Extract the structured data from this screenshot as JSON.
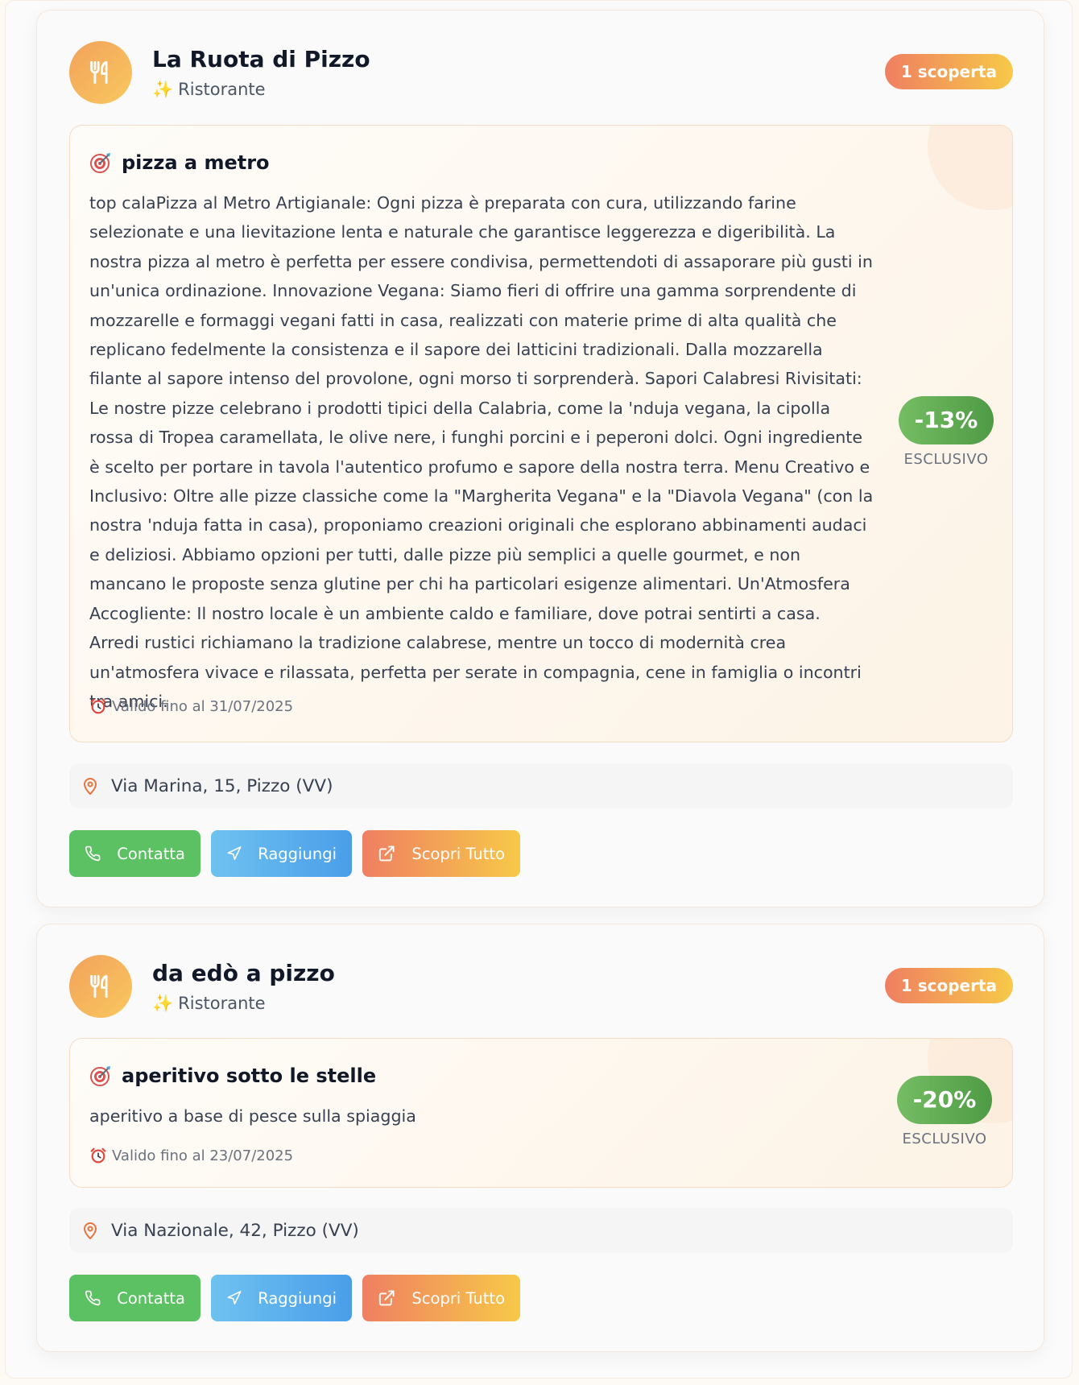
{
  "cards": [
    {
      "name": "La Ruota di Pizzo",
      "category": "Ristorante",
      "badge": "1 scoperta",
      "offer": {
        "title": "pizza a metro",
        "description": "top calaPizza al Metro Artigianale: Ogni pizza è preparata con cura, utilizzando farine selezionate e una lievitazione lenta e naturale che garantisce leggerezza e digeribilità. La nostra pizza al metro è perfetta per essere condivisa, permettendoti di assaporare più gusti in un'unica ordinazione. Innovazione Vegana: Siamo fieri di offrire una gamma sorprendente di mozzarelle e formaggi vegani fatti in casa, realizzati con materie prime di alta qualità che replicano fedelmente la consistenza e il sapore dei latticini tradizionali. Dalla mozzarella filante al sapore intenso del provolone, ogni morso ti sorprenderà. Sapori Calabresi Rivisitati: Le nostre pizze celebrano i prodotti tipici della Calabria, come la 'nduja vegana, la cipolla rossa di Tropea caramellata, le olive nere, i funghi porcini e i peperoni dolci. Ogni ingrediente è scelto per portare in tavola l'autentico profumo e sapore della nostra terra. Menu Creativo e Inclusivo: Oltre alle pizze classiche come la \"Margherita Vegana\" e la \"Diavola Vegana\" (con la nostra 'nduja fatta in casa), proponiamo creazioni originali che esplorano abbinamenti audaci e deliziosi. Abbiamo opzioni per tutti, dalle pizze più semplici a quelle gourmet, e non mancano le proposte senza glutine per chi ha particolari esigenze alimentari. Un'Atmosfera Accogliente: Il nostro locale è un ambiente caldo e familiare, dove potrai sentirti a casa. Arredi rustici richiamano la tradizione calabrese, mentre un tocco di modernità crea un'atmosfera vivace e rilassata, perfetta per serate in compagnia, cene in famiglia o incontri tra amici.",
        "validity": "Valido fino al 31/07/2025",
        "discount": "-13%",
        "exclusive_label": "ESCLUSIVO"
      },
      "address": "Via Marina, 15, Pizzo (VV)",
      "actions": {
        "contact": "Contatta",
        "route": "Raggiungi",
        "discover": "Scopri Tutto"
      }
    },
    {
      "name": "da edò a pizzo",
      "category": "Ristorante",
      "badge": "1 scoperta",
      "offer": {
        "title": "aperitivo sotto le stelle",
        "description": "aperitivo a base di pesce sulla spiaggia",
        "validity": "Valido fino al 23/07/2025",
        "discount": "-20%",
        "exclusive_label": "ESCLUSIVO"
      },
      "address": "Via Nazionale, 42, Pizzo (VV)",
      "actions": {
        "contact": "Contatta",
        "route": "Raggiungi",
        "discover": "Scopri Tutto"
      }
    }
  ],
  "icons": {
    "avatar": "fork-knife-icon",
    "category": "sparkles-icon",
    "offer": "target-icon",
    "validity": "alarm-clock-icon",
    "address": "map-pin-icon",
    "contact": "phone-icon",
    "route": "navigation-arrow-icon",
    "discover": "external-link-icon"
  },
  "colors": {
    "accent_gradient": [
      "#ef7f62",
      "#f7c948"
    ],
    "discount_green": "#5ea852",
    "contact_green": "#5cc163",
    "route_blue": "#4a9ee8"
  }
}
